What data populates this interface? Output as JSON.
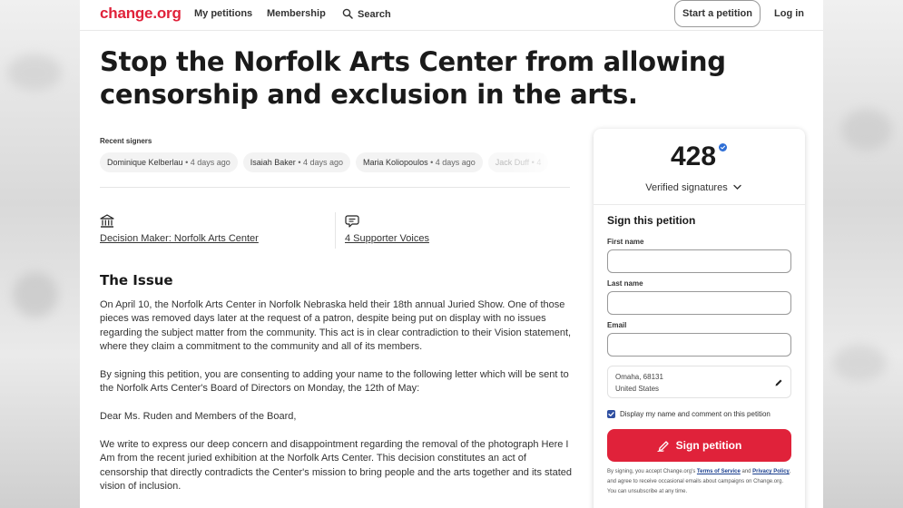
{
  "header": {
    "logo": "change.org",
    "nav": {
      "my_petitions": "My petitions",
      "membership": "Membership",
      "search": "Search"
    },
    "start_petition": "Start a petition",
    "login": "Log in"
  },
  "petition": {
    "title_line1": "Stop the Norfolk Arts Center from allowing",
    "title_line2": "censorship and exclusion in the arts."
  },
  "recent_signers": {
    "label": "Recent signers",
    "items": [
      {
        "name": "Dominique Kelberlau",
        "ago": "4 days ago"
      },
      {
        "name": "Isaiah Baker",
        "ago": "4 days ago"
      },
      {
        "name": "Maria Koliopoulos",
        "ago": "4 days ago"
      },
      {
        "name": "Jack Duff",
        "ago": "4"
      }
    ]
  },
  "info": {
    "decision_maker": "Decision Maker: Norfolk Arts Center",
    "supporter_voices": "4 Supporter Voices"
  },
  "issue": {
    "heading": "The Issue",
    "paragraphs": [
      "On April 10, the Norfolk Arts Center in Norfolk Nebraska held their 18th annual Juried Show. One of those pieces was removed days later at the request of a patron, despite being put on display with no issues regarding the subject matter from the community. This act is in clear contradiction to their Vision statement, where they claim a commitment to the community and all of its members.",
      "By signing this petition, you are consenting to adding your name to the following letter which will be sent to the Norfolk Arts Center's Board of Directors on Monday, the 12th of May:",
      "Dear Ms. Ruden and Members of the Board,",
      "We write to express our deep concern and disappointment regarding the removal of the photograph Here I Am from the recent juried exhibition at the Norfolk Arts Center. This decision constitutes an act of censorship that directly contradicts the Center's mission to bring people and the arts together and its stated vision of inclusion."
    ]
  },
  "sign_card": {
    "count": "428",
    "verified_label": "Verified signatures",
    "heading": "Sign this petition",
    "first_name_label": "First name",
    "last_name_label": "Last name",
    "email_label": "Email",
    "first_name_value": "",
    "last_name_value": "",
    "email_value": "",
    "location_line1": "Omaha, 68131",
    "location_line2": "United States",
    "display_checkbox_label": "Display my name and comment on this petition",
    "display_checked": true,
    "sign_button": "Sign petition",
    "fine_print_prefix": "By signing, you accept Change.org's",
    "terms_link": "Terms of Service",
    "and": "and",
    "privacy_link": "Privacy Policy",
    "fine_print_suffix": ", and agree to receive occasional emails about campaigns on Change.org. You can unsubscribe at any time."
  },
  "colors": {
    "brand_red": "#e0223a",
    "verified_blue": "#2f6fd6",
    "checkbox_blue": "#2f4fa1"
  }
}
